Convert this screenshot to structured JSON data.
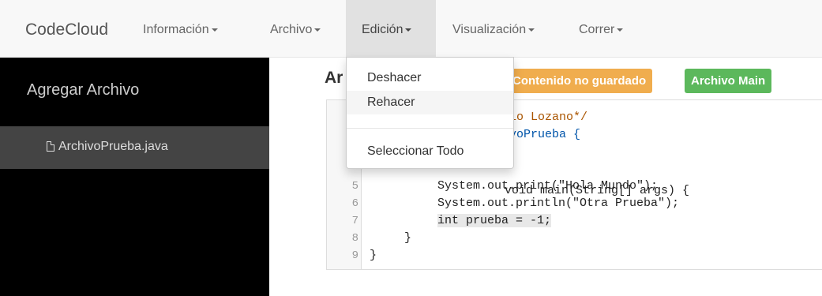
{
  "navbar": {
    "brand": "CodeCloud",
    "items": [
      {
        "label": "Información"
      },
      {
        "label": "Archivo"
      },
      {
        "label": "Edición"
      },
      {
        "label": "Visualización"
      },
      {
        "label": "Correr"
      }
    ],
    "active": "Edición"
  },
  "sidebar": {
    "title": "Agregar Archivo",
    "files": [
      {
        "name": "ArchivoPrueba.java",
        "icon": "file-icon"
      }
    ]
  },
  "main": {
    "title_partial": "Ar",
    "badges": {
      "unsaved": "Contenido no guardado",
      "main": "Archivo Main"
    },
    "badge_colors": {
      "warning": "#f0ad4e",
      "success": "#5cb85c"
    }
  },
  "editor": {
    "line_numbers": [
      "5",
      "6",
      "7",
      "8",
      "9"
    ],
    "visible_fragments": {
      "line1": "nio Lozano*/",
      "line2_class": "ivoPrueba {",
      "line4_tail": "void main(String[] args) {",
      "line5": "System.out.print(\"Hola Mundo\");",
      "line6": "System.out.println(\"Otra Prueba\");",
      "line7": "int prueba = -1;",
      "line8": "}",
      "line9": "}"
    }
  },
  "dropdown": {
    "items": [
      {
        "label": "Deshacer"
      },
      {
        "label": "Rehacer"
      },
      {
        "label": "Seleccionar Todo"
      }
    ]
  }
}
